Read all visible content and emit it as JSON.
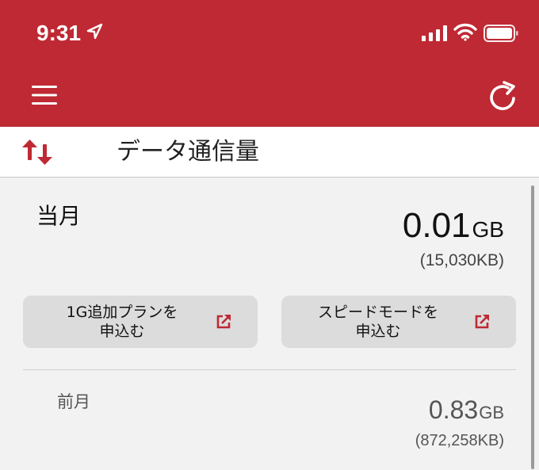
{
  "colors": {
    "brand": "#be2933",
    "background": "#f2f2f2",
    "button": "#dcdcdc"
  },
  "status_bar": {
    "time": "9:31",
    "icons": [
      "location-arrow-icon",
      "signal-icon",
      "wifi-icon",
      "battery-icon"
    ]
  },
  "nav": {
    "left_icon": "menu-icon",
    "right_icon": "refresh-icon"
  },
  "title_bar": {
    "icon": "data-transfer-icon",
    "title": "データ通信量"
  },
  "current_month": {
    "label": "当月",
    "value": "0.01",
    "unit": "GB",
    "kb": "(15,030KB)"
  },
  "buttons": [
    {
      "label": "1G追加プランを\n申込む",
      "icon": "external-link-icon"
    },
    {
      "label": "スピードモードを\n申込む",
      "icon": "external-link-icon"
    }
  ],
  "previous_month": {
    "label": "前月",
    "value": "0.83",
    "unit": "GB",
    "kb": "(872,258KB)"
  }
}
